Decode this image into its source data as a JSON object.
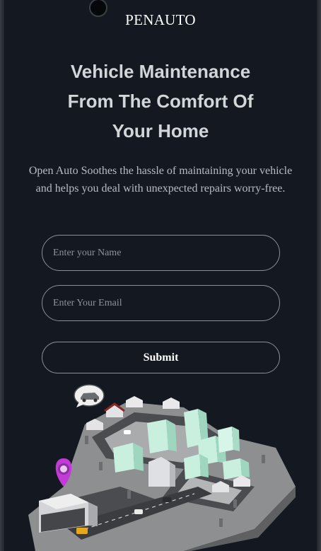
{
  "brand": "PENAUTO",
  "hero": {
    "title_lines": [
      "Vehicle Maintenance",
      "From The Comfort Of",
      "Your Home"
    ],
    "description_lines": [
      "Open Auto Soothes the hassle of maintaining your vehicle",
      "and helps you deal with unexpected repairs worry-free."
    ]
  },
  "form": {
    "name_placeholder": "Enter your Name",
    "email_placeholder": "Enter Your Email",
    "submit_label": "Submit"
  },
  "illustration": {
    "icons": [
      "car-speech-bubble-icon",
      "map-pin-icon"
    ],
    "colors": {
      "pin": "#c23ad8",
      "buildings": "#c9f0df",
      "ground": "#8e8f91"
    }
  }
}
